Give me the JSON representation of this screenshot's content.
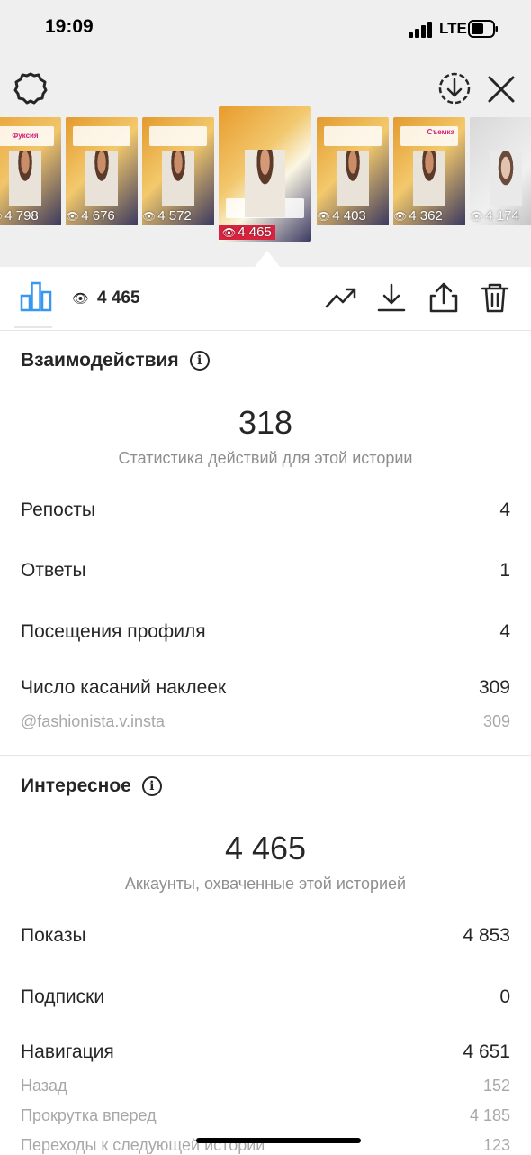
{
  "status": {
    "time": "19:09",
    "network": "LTE"
  },
  "thumbnails": [
    {
      "views": "4 798",
      "caption": "Фуксия"
    },
    {
      "views": "4 676",
      "caption": ""
    },
    {
      "views": "4 572",
      "caption": ""
    },
    {
      "views": "4 465",
      "caption": "",
      "selected": true
    },
    {
      "views": "4 403",
      "caption": ""
    },
    {
      "views": "4 362",
      "caption": "Съемка"
    },
    {
      "views": "4 174",
      "caption": ""
    }
  ],
  "toolbar": {
    "views_total": "4 465"
  },
  "interactions": {
    "title": "Взаимодействия",
    "total": "318",
    "subtitle": "Статистика действий для этой истории",
    "rows": [
      {
        "label": "Репосты",
        "value": "4"
      },
      {
        "label": "Ответы",
        "value": "1"
      },
      {
        "label": "Посещения профиля",
        "value": "4"
      },
      {
        "label": "Число касаний наклеек",
        "value": "309"
      }
    ],
    "sticker": {
      "label": "@fashionista.v.insta",
      "value": "309"
    }
  },
  "discovery": {
    "title": "Интересное",
    "total": "4 465",
    "subtitle": "Аккаунты, охваченные этой историей",
    "rows": [
      {
        "label": "Показы",
        "value": "4 853"
      },
      {
        "label": "Подписки",
        "value": "0"
      },
      {
        "label": "Навигация",
        "value": "4 651"
      }
    ],
    "navigation": [
      {
        "label": "Назад",
        "value": "152"
      },
      {
        "label": "Прокрутка вперед",
        "value": "4 185"
      },
      {
        "label": "Переходы к следующей истории",
        "value": "123"
      }
    ]
  },
  "colors": {
    "accent": "#3897f0",
    "muted": "#8e8e8e"
  }
}
